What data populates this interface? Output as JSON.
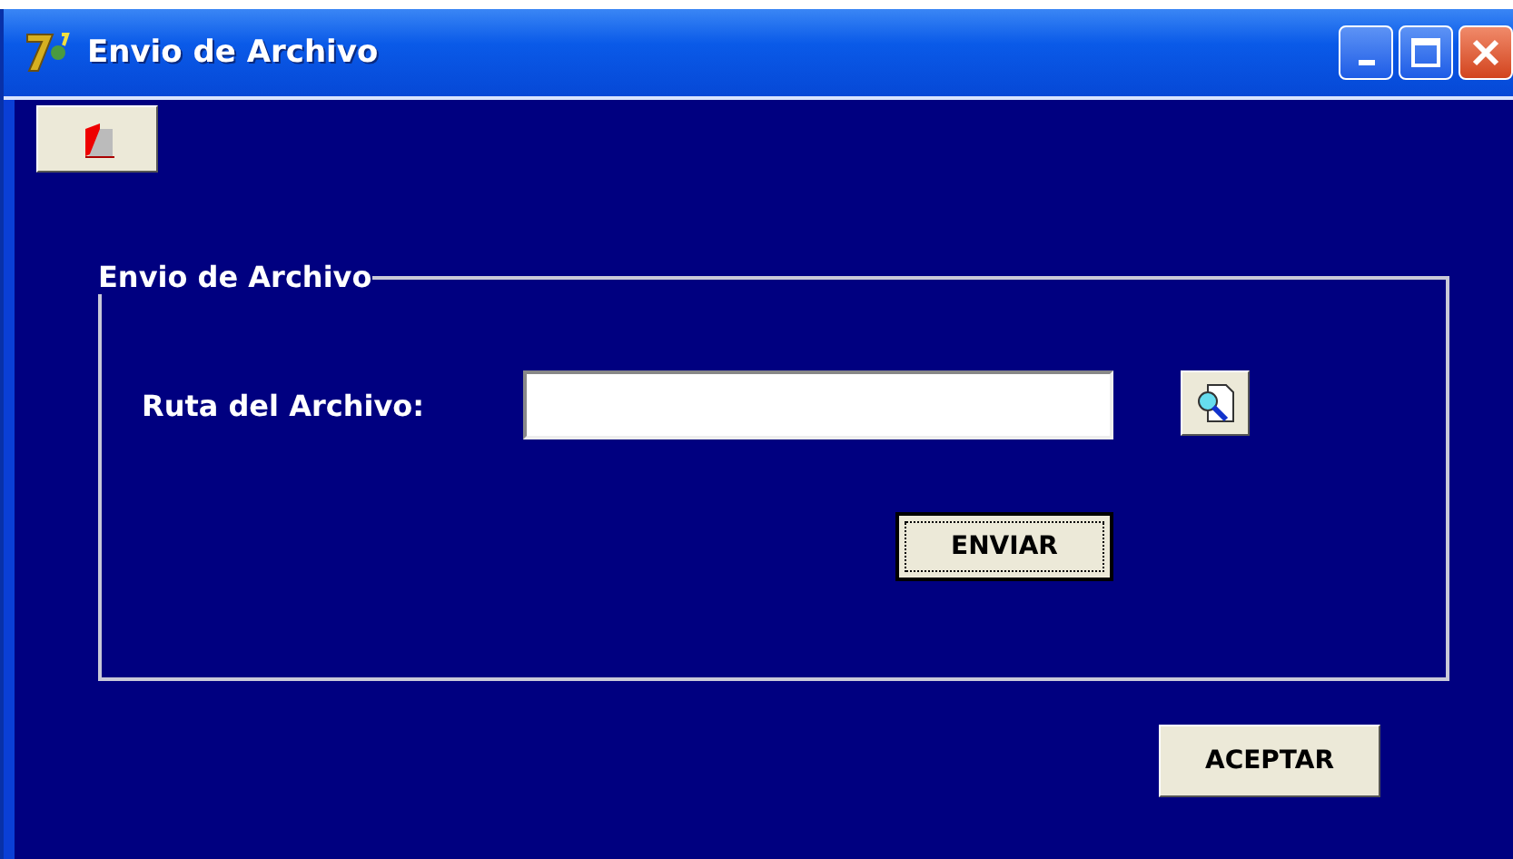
{
  "window": {
    "title": "Envio de Archivo"
  },
  "group": {
    "title": "Envio de Archivo",
    "path_label": "Ruta del Archivo:",
    "send_button": "ENVIAR"
  },
  "accept_button": "ACEPTAR"
}
